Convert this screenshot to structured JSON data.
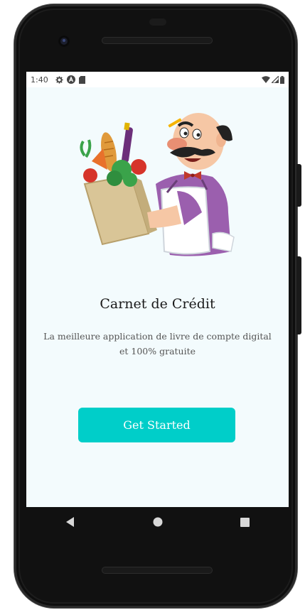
{
  "status_bar": {
    "time": "1:40",
    "left_icons": [
      "gear-icon",
      "a-circle-icon",
      "sd-card-icon"
    ],
    "right_icons": [
      "wifi-icon",
      "signal-icon",
      "battery-icon"
    ]
  },
  "onboarding": {
    "title": "Carnet de Crédit",
    "subtitle": "La meilleure application de livre de compte digital et 100% gratuite",
    "cta_label": "Get Started",
    "illustration": "grocer-with-grocery-bag-illustration"
  },
  "nav_bar": {
    "buttons": [
      "back-icon",
      "home-icon",
      "recents-icon"
    ]
  },
  "colors": {
    "accent": "#00cec9",
    "screen_background": "#f3fbfd",
    "title_text": "#1a1a1a",
    "subtitle_text": "#555555"
  }
}
